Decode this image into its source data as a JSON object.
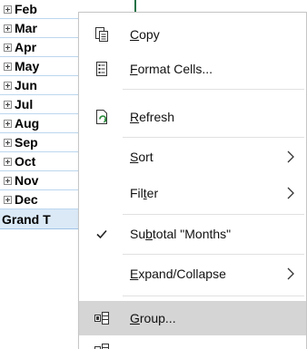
{
  "pivot": {
    "rows": [
      {
        "label": "Feb"
      },
      {
        "label": "Mar"
      },
      {
        "label": "Apr"
      },
      {
        "label": "May"
      },
      {
        "label": "Jun"
      },
      {
        "label": "Jul"
      },
      {
        "label": "Aug"
      },
      {
        "label": "Sep"
      },
      {
        "label": "Oct"
      },
      {
        "label": "Nov"
      },
      {
        "label": "Dec"
      }
    ],
    "grand_label": "Grand T"
  },
  "context_menu": {
    "items": [
      {
        "pre": "",
        "u": "C",
        "post": "opy",
        "icon": "copy-icon",
        "submenu": false
      },
      {
        "pre": "",
        "u": "F",
        "post": "ormat Cells...",
        "icon": "format-cells-icon",
        "submenu": false
      },
      {
        "pre": "",
        "u": "R",
        "post": "efresh",
        "icon": "refresh-icon",
        "submenu": false
      },
      {
        "pre": "",
        "u": "S",
        "post": "ort",
        "icon": "",
        "submenu": true
      },
      {
        "pre": "Fil",
        "u": "t",
        "post": "er",
        "icon": "",
        "submenu": true
      },
      {
        "pre": "Su",
        "u": "b",
        "post": "total \"Months\"",
        "icon": "checkmark-icon",
        "submenu": false
      },
      {
        "pre": "",
        "u": "E",
        "post": "xpand/Collapse",
        "icon": "",
        "submenu": true
      },
      {
        "pre": "",
        "u": "G",
        "post": "roup...",
        "icon": "group-icon",
        "submenu": false,
        "hover": true
      }
    ]
  },
  "colors": {
    "row_border": "#bcd7ee",
    "grand_total_bg": "#dbe9f7",
    "menu_hover_bg": "#d5d5d5",
    "refresh_accent": "#2e8b3d",
    "active_cell": "#217346"
  }
}
